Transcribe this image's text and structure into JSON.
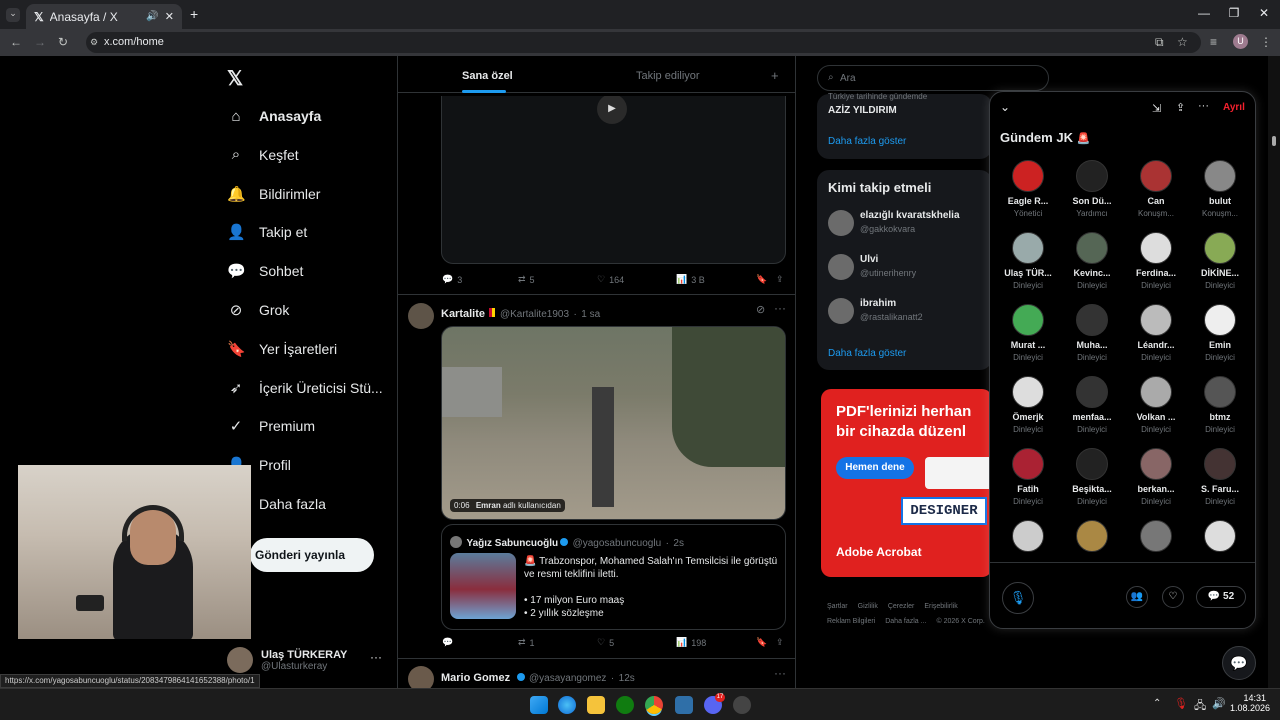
{
  "browser": {
    "tab_title": "Anasayfa / X",
    "url": "x.com/home",
    "status_url": "https://x.com/yagosabuncuoglu/status/2083479864141652388/photo/1"
  },
  "nav": {
    "items": [
      {
        "label": "Anasayfa",
        "icon": "home-icon"
      },
      {
        "label": "Keşfet",
        "icon": "search-icon"
      },
      {
        "label": "Bildirimler",
        "icon": "bell-icon"
      },
      {
        "label": "Takip et",
        "icon": "add-user-icon"
      },
      {
        "label": "Sohbet",
        "icon": "chat-icon"
      },
      {
        "label": "Grok",
        "icon": "grok-icon"
      },
      {
        "label": "Yer İşaretleri",
        "icon": "bookmark-icon"
      },
      {
        "label": "İçerik Üreticisi Stü...",
        "icon": "rocket-icon"
      },
      {
        "label": "Premium",
        "icon": "check-circle-icon"
      },
      {
        "label": "Profil",
        "icon": "person-icon"
      },
      {
        "label": "Daha fazla",
        "icon": "more-icon"
      }
    ],
    "post_button": "Gönderi yayınla",
    "user": {
      "name": "Ulaş TÜRKERAY",
      "handle": "@Ulasturkeray"
    }
  },
  "timeline": {
    "tabs": [
      "Sana özel",
      "Takip ediliyor"
    ],
    "tweet1": {
      "replies": "3",
      "retweets": "5",
      "likes": "164",
      "views": "3 B"
    },
    "tweet2": {
      "name": "Kartalite",
      "handle": "@Kartalite1903",
      "time": "1 sa",
      "video_time": "0:06",
      "video_user": "Emran",
      "video_caption": "adlı kullanıcıdan",
      "quote": {
        "name": "Yağız Sabuncuoğlu",
        "handle": "@yagosabuncuoglu",
        "time": "2s",
        "line1": "Trabzonspor, Mohamed Salah'ın Temsilcisi ile görüştü ve resmi teklifini iletti.",
        "line2": "• 17 milyon Euro maaş",
        "line3": "• 2 yıllık sözleşme"
      },
      "replies": "",
      "retweets": "1",
      "likes": "5",
      "views": "198"
    },
    "tweet3": {
      "name": "Mario Gomez",
      "handle": "@yasayangomez",
      "time": "12s"
    }
  },
  "right": {
    "search_placeholder": "Ara",
    "trend_meta": "Türkiye tarihinde gündemde",
    "trend_name": "AZİZ YILDIRIM",
    "show_more": "Daha fazla göster",
    "follow_title": "Kimi takip etmeli",
    "follow": [
      {
        "name": "elazığlı kvaratskhelia",
        "handle": "@gakkokvara"
      },
      {
        "name": "Ulvi",
        "handle": "@utinerihenry"
      },
      {
        "name": "ibrahim",
        "handle": "@rastalikanatt2"
      }
    ],
    "show_more2": "Daha fazla göster",
    "ad": {
      "line1": "PDF'lerinizi herhan",
      "line2": "bir cihazda düzenl",
      "button": "Hemen dene",
      "designer": "DESIGNER",
      "brand": "Adobe Acrobat"
    },
    "footer": [
      "Şartlar",
      "Gizlilik",
      "Çerezler",
      "Erişebilirlik",
      "Reklam Bilgileri",
      "Daha fazla ...",
      "© 2026 X Corp."
    ]
  },
  "space": {
    "title": "Gündem JK",
    "leave": "Ayrıl",
    "participants": [
      {
        "name": "Eagle R...",
        "role": "Yönetici"
      },
      {
        "name": "Son Dü...",
        "role": "Yardımcı"
      },
      {
        "name": "Can",
        "role": "Konuşm..."
      },
      {
        "name": "bulut",
        "role": "Konuşm..."
      },
      {
        "name": "Ulaş TÜR...",
        "role": "Dinleyici"
      },
      {
        "name": "Kevinc...",
        "role": "Dinleyici"
      },
      {
        "name": "Ferdina...",
        "role": "Dinleyici"
      },
      {
        "name": "DİKİNE...",
        "role": "Dinleyici"
      },
      {
        "name": "Murat ...",
        "role": "Dinleyici"
      },
      {
        "name": "Muha...",
        "role": "Dinleyici"
      },
      {
        "name": "Léandr...",
        "role": "Dinleyici"
      },
      {
        "name": "Emin",
        "role": "Dinleyici"
      },
      {
        "name": "Ömerjk",
        "role": "Dinleyici"
      },
      {
        "name": "menfaa...",
        "role": "Dinleyici"
      },
      {
        "name": "Volkan ...",
        "role": "Dinleyici"
      },
      {
        "name": "btmz",
        "role": "Dinleyici"
      },
      {
        "name": "Fatih",
        "role": "Dinleyici"
      },
      {
        "name": "Beşikta...",
        "role": "Dinleyici"
      },
      {
        "name": "berkan...",
        "role": "Dinleyici"
      },
      {
        "name": "S. Faru...",
        "role": "Dinleyici"
      }
    ],
    "comments": "52"
  },
  "taskbar": {
    "time": "14:31",
    "date": "1.08.2026",
    "discord_badge": "17"
  },
  "colors": {
    "accent": "#1d9bf0",
    "background": "#000000",
    "ad_red": "#e0211f"
  }
}
